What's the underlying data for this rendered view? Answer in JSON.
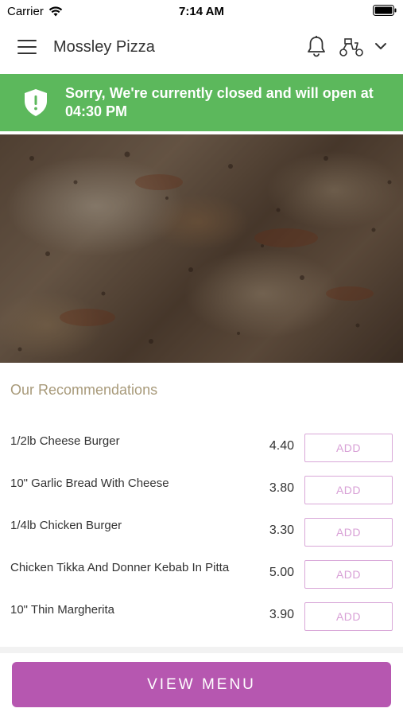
{
  "status_bar": {
    "carrier": "Carrier",
    "time": "7:14 AM"
  },
  "header": {
    "title": "Mossley Pizza",
    "icons": [
      "menu-icon",
      "bell-icon",
      "delivery-scooter-icon",
      "chevron-down-icon"
    ]
  },
  "banner": {
    "message": "Sorry, We're currently closed and will open at 04:30 PM",
    "color": "#5cb85c",
    "icon": "shield-alert-icon"
  },
  "recommendations": {
    "title": "Our Recommendations",
    "items": [
      {
        "name": "1/2lb Cheese Burger",
        "price": "4.40",
        "button": "ADD"
      },
      {
        "name": "10\" Garlic Bread With Cheese",
        "price": "3.80",
        "button": "ADD"
      },
      {
        "name": "1/4lb Chicken Burger",
        "price": "3.30",
        "button": "ADD"
      },
      {
        "name": "Chicken Tikka And Donner Kebab In Pitta",
        "price": "5.00",
        "button": "ADD"
      },
      {
        "name": "10\" Thin Margherita",
        "price": "3.90",
        "button": "ADD"
      }
    ]
  },
  "footer": {
    "view_menu_label": "VIEW MENU",
    "accent_color": "#b657b0"
  }
}
